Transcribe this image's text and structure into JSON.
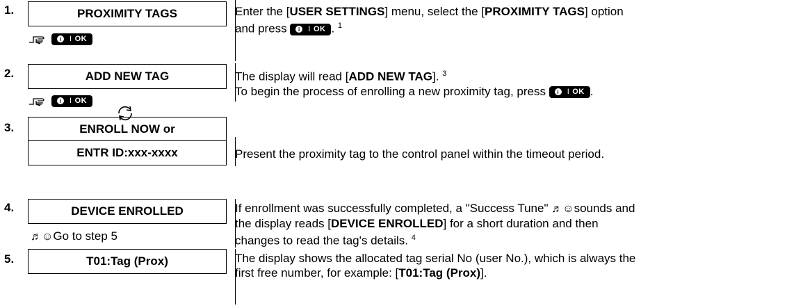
{
  "ok_key": {
    "info": "i",
    "sep": "I",
    "label": "OK"
  },
  "steps": [
    {
      "num": "1.",
      "display": "PROXIMITY TAGS",
      "desc": {
        "a": "Enter the [",
        "b": "USER SETTINGS",
        "c": "] menu, select the [",
        "d": "PROXIMITY TAGS",
        "e": "] option",
        "f": "and press ",
        "g": ".",
        "sup": "1"
      }
    },
    {
      "num": "2.",
      "display": "ADD NEW TAG",
      "desc": {
        "a": "The display will read [",
        "b": "ADD NEW TAG",
        "c": "].",
        "sup": "3",
        "d": "To begin the process of enrolling a new proximity tag, press ",
        "e": "."
      }
    },
    {
      "num": "3.",
      "display": "ENROLL NOW or",
      "display2": "ENTR ID:xxx-xxxx",
      "desc2": "Present the proximity tag to the control panel within the timeout period."
    },
    {
      "num": "4.",
      "display": "DEVICE ENROLLED",
      "note": "Go to step 5",
      "tune_glyphs": "♬☺",
      "desc": {
        "a": "If enrollment was successfully completed, a \"Success Tune\" ",
        "b": "sounds and",
        "c": "the display reads [",
        "d": "DEVICE ENROLLED",
        "e": "] for a short duration and then",
        "f": "changes to read the tag's details.",
        "sup": "4"
      }
    },
    {
      "num": "5.",
      "display": "T01:Tag (Prox)",
      "desc": {
        "a": "The display shows the allocated tag serial No (user No.), which is always the",
        "b": "first free number, for example: [",
        "c": "T01:Tag (Prox)",
        "d": "]."
      }
    }
  ]
}
